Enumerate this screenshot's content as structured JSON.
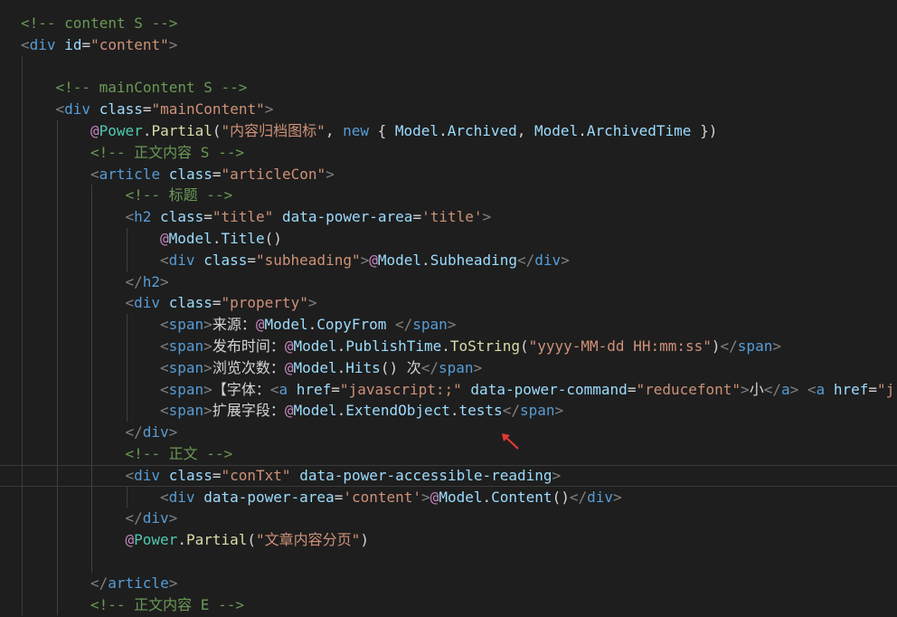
{
  "editor": {
    "lines": [
      {
        "indent": 0,
        "tokens": [
          {
            "t": "<!-- content S -->",
            "c": "cmt"
          }
        ]
      },
      {
        "indent": 0,
        "tokens": [
          {
            "t": "<",
            "c": "brk"
          },
          {
            "t": "div",
            "c": "tag"
          },
          {
            "t": " ",
            "c": "txt"
          },
          {
            "t": "id",
            "c": "attr"
          },
          {
            "t": "=",
            "c": "txt"
          },
          {
            "t": "\"content\"",
            "c": "str"
          },
          {
            "t": ">",
            "c": "brk"
          }
        ]
      },
      {
        "indent": 0,
        "tokens": []
      },
      {
        "indent": 1,
        "tokens": [
          {
            "t": "<!-- mainContent S -->",
            "c": "cmt"
          }
        ]
      },
      {
        "indent": 1,
        "tokens": [
          {
            "t": "<",
            "c": "brk"
          },
          {
            "t": "div",
            "c": "tag"
          },
          {
            "t": " ",
            "c": "txt"
          },
          {
            "t": "class",
            "c": "attr"
          },
          {
            "t": "=",
            "c": "txt"
          },
          {
            "t": "\"mainContent\"",
            "c": "str"
          },
          {
            "t": ">",
            "c": "brk"
          }
        ]
      },
      {
        "indent": 2,
        "tokens": [
          {
            "t": "@",
            "c": "at"
          },
          {
            "t": "Power",
            "c": "cls"
          },
          {
            "t": ".",
            "c": "txt"
          },
          {
            "t": "Partial",
            "c": "fn"
          },
          {
            "t": "(",
            "c": "txt"
          },
          {
            "t": "\"内容归档图标\"",
            "c": "str"
          },
          {
            "t": ", ",
            "c": "txt"
          },
          {
            "t": "new",
            "c": "kw"
          },
          {
            "t": " { ",
            "c": "txt"
          },
          {
            "t": "Model",
            "c": "attr"
          },
          {
            "t": ".",
            "c": "txt"
          },
          {
            "t": "Archived",
            "c": "attr"
          },
          {
            "t": ", ",
            "c": "txt"
          },
          {
            "t": "Model",
            "c": "attr"
          },
          {
            "t": ".",
            "c": "txt"
          },
          {
            "t": "ArchivedTime",
            "c": "attr"
          },
          {
            "t": " })",
            "c": "txt"
          }
        ]
      },
      {
        "indent": 2,
        "tokens": [
          {
            "t": "<!-- 正文内容 S -->",
            "c": "cmt"
          }
        ]
      },
      {
        "indent": 2,
        "tokens": [
          {
            "t": "<",
            "c": "brk"
          },
          {
            "t": "article",
            "c": "tag"
          },
          {
            "t": " ",
            "c": "txt"
          },
          {
            "t": "class",
            "c": "attr"
          },
          {
            "t": "=",
            "c": "txt"
          },
          {
            "t": "\"articleCon\"",
            "c": "str"
          },
          {
            "t": ">",
            "c": "brk"
          }
        ]
      },
      {
        "indent": 3,
        "tokens": [
          {
            "t": "<!-- 标题 -->",
            "c": "cmt"
          }
        ]
      },
      {
        "indent": 3,
        "tokens": [
          {
            "t": "<",
            "c": "brk"
          },
          {
            "t": "h2",
            "c": "tag"
          },
          {
            "t": " ",
            "c": "txt"
          },
          {
            "t": "class",
            "c": "attr"
          },
          {
            "t": "=",
            "c": "txt"
          },
          {
            "t": "\"title\"",
            "c": "str"
          },
          {
            "t": " ",
            "c": "txt"
          },
          {
            "t": "data-power-area",
            "c": "attr"
          },
          {
            "t": "=",
            "c": "txt"
          },
          {
            "t": "'title'",
            "c": "str"
          },
          {
            "t": ">",
            "c": "brk"
          }
        ]
      },
      {
        "indent": 4,
        "tokens": [
          {
            "t": "@",
            "c": "at"
          },
          {
            "t": "Model",
            "c": "attr"
          },
          {
            "t": ".",
            "c": "txt"
          },
          {
            "t": "Title",
            "c": "attr"
          },
          {
            "t": "()",
            "c": "txt"
          }
        ]
      },
      {
        "indent": 4,
        "tokens": [
          {
            "t": "<",
            "c": "brk"
          },
          {
            "t": "div",
            "c": "tag"
          },
          {
            "t": " ",
            "c": "txt"
          },
          {
            "t": "class",
            "c": "attr"
          },
          {
            "t": "=",
            "c": "txt"
          },
          {
            "t": "\"subheading\"",
            "c": "str"
          },
          {
            "t": ">",
            "c": "brk"
          },
          {
            "t": "@",
            "c": "at"
          },
          {
            "t": "Model",
            "c": "attr"
          },
          {
            "t": ".",
            "c": "txt"
          },
          {
            "t": "Subheading",
            "c": "attr"
          },
          {
            "t": "</",
            "c": "brk"
          },
          {
            "t": "div",
            "c": "tag"
          },
          {
            "t": ">",
            "c": "brk"
          }
        ]
      },
      {
        "indent": 3,
        "tokens": [
          {
            "t": "</",
            "c": "brk"
          },
          {
            "t": "h2",
            "c": "tag"
          },
          {
            "t": ">",
            "c": "brk"
          }
        ]
      },
      {
        "indent": 3,
        "tokens": [
          {
            "t": "<",
            "c": "brk"
          },
          {
            "t": "div",
            "c": "tag"
          },
          {
            "t": " ",
            "c": "txt"
          },
          {
            "t": "class",
            "c": "attr"
          },
          {
            "t": "=",
            "c": "txt"
          },
          {
            "t": "\"property\"",
            "c": "str"
          },
          {
            "t": ">",
            "c": "brk"
          }
        ]
      },
      {
        "indent": 4,
        "tokens": [
          {
            "t": "<",
            "c": "brk"
          },
          {
            "t": "span",
            "c": "tag"
          },
          {
            "t": ">",
            "c": "brk"
          },
          {
            "t": "来源：",
            "c": "txt"
          },
          {
            "t": "@",
            "c": "at"
          },
          {
            "t": "Model",
            "c": "attr"
          },
          {
            "t": ".",
            "c": "txt"
          },
          {
            "t": "CopyFrom",
            "c": "attr"
          },
          {
            "t": " ",
            "c": "txt"
          },
          {
            "t": "</",
            "c": "brk"
          },
          {
            "t": "span",
            "c": "tag"
          },
          {
            "t": ">",
            "c": "brk"
          }
        ]
      },
      {
        "indent": 4,
        "tokens": [
          {
            "t": "<",
            "c": "brk"
          },
          {
            "t": "span",
            "c": "tag"
          },
          {
            "t": ">",
            "c": "brk"
          },
          {
            "t": "发布时间：",
            "c": "txt"
          },
          {
            "t": "@",
            "c": "at"
          },
          {
            "t": "Model",
            "c": "attr"
          },
          {
            "t": ".",
            "c": "txt"
          },
          {
            "t": "PublishTime",
            "c": "attr"
          },
          {
            "t": ".",
            "c": "txt"
          },
          {
            "t": "ToString",
            "c": "fn"
          },
          {
            "t": "(",
            "c": "txt"
          },
          {
            "t": "\"yyyy-MM-dd HH:mm:ss\"",
            "c": "str"
          },
          {
            "t": ")",
            "c": "txt"
          },
          {
            "t": "</",
            "c": "brk"
          },
          {
            "t": "span",
            "c": "tag"
          },
          {
            "t": ">",
            "c": "brk"
          }
        ]
      },
      {
        "indent": 4,
        "tokens": [
          {
            "t": "<",
            "c": "brk"
          },
          {
            "t": "span",
            "c": "tag"
          },
          {
            "t": ">",
            "c": "brk"
          },
          {
            "t": "浏览次数：",
            "c": "txt"
          },
          {
            "t": "@",
            "c": "at"
          },
          {
            "t": "Model",
            "c": "attr"
          },
          {
            "t": ".",
            "c": "txt"
          },
          {
            "t": "Hits",
            "c": "attr"
          },
          {
            "t": "() 次",
            "c": "txt"
          },
          {
            "t": "</",
            "c": "brk"
          },
          {
            "t": "span",
            "c": "tag"
          },
          {
            "t": ">",
            "c": "brk"
          }
        ]
      },
      {
        "indent": 4,
        "tokens": [
          {
            "t": "<",
            "c": "brk"
          },
          {
            "t": "span",
            "c": "tag"
          },
          {
            "t": ">",
            "c": "brk"
          },
          {
            "t": "【字体：",
            "c": "txt"
          },
          {
            "t": "<",
            "c": "brk"
          },
          {
            "t": "a",
            "c": "tag"
          },
          {
            "t": " ",
            "c": "txt"
          },
          {
            "t": "href",
            "c": "attr"
          },
          {
            "t": "=",
            "c": "txt"
          },
          {
            "t": "\"javascript:;\"",
            "c": "str"
          },
          {
            "t": " ",
            "c": "txt"
          },
          {
            "t": "data-power-command",
            "c": "attr"
          },
          {
            "t": "=",
            "c": "txt"
          },
          {
            "t": "\"reducefont\"",
            "c": "str"
          },
          {
            "t": ">",
            "c": "brk"
          },
          {
            "t": "小",
            "c": "txt"
          },
          {
            "t": "</",
            "c": "brk"
          },
          {
            "t": "a",
            "c": "tag"
          },
          {
            "t": ">",
            "c": "brk"
          },
          {
            "t": " ",
            "c": "txt"
          },
          {
            "t": "<",
            "c": "brk"
          },
          {
            "t": "a",
            "c": "tag"
          },
          {
            "t": " ",
            "c": "txt"
          },
          {
            "t": "href",
            "c": "attr"
          },
          {
            "t": "=",
            "c": "txt"
          },
          {
            "t": "\"j",
            "c": "str"
          }
        ]
      },
      {
        "indent": 4,
        "tokens": [
          {
            "t": "<",
            "c": "brk"
          },
          {
            "t": "span",
            "c": "tag"
          },
          {
            "t": ">",
            "c": "brk"
          },
          {
            "t": "扩展字段：",
            "c": "txt"
          },
          {
            "t": "@",
            "c": "at"
          },
          {
            "t": "Model",
            "c": "attr"
          },
          {
            "t": ".",
            "c": "txt"
          },
          {
            "t": "ExtendObject",
            "c": "attr"
          },
          {
            "t": ".",
            "c": "txt"
          },
          {
            "t": "tests",
            "c": "attr"
          },
          {
            "t": "</",
            "c": "brk"
          },
          {
            "t": "span",
            "c": "tag"
          },
          {
            "t": ">",
            "c": "brk"
          }
        ]
      },
      {
        "indent": 3,
        "tokens": [
          {
            "t": "</",
            "c": "brk"
          },
          {
            "t": "div",
            "c": "tag"
          },
          {
            "t": ">",
            "c": "brk"
          }
        ]
      },
      {
        "indent": 3,
        "tokens": [
          {
            "t": "<!-- 正文 -->",
            "c": "cmt"
          }
        ]
      },
      {
        "indent": 3,
        "current": true,
        "tokens": [
          {
            "t": "<",
            "c": "brk"
          },
          {
            "t": "div",
            "c": "tag"
          },
          {
            "t": " ",
            "c": "txt"
          },
          {
            "t": "class",
            "c": "attr"
          },
          {
            "t": "=",
            "c": "txt"
          },
          {
            "t": "\"conTxt\"",
            "c": "str"
          },
          {
            "t": " ",
            "c": "txt"
          },
          {
            "t": "data-power-accessible-reading",
            "c": "attr"
          },
          {
            "t": ">",
            "c": "brk"
          }
        ]
      },
      {
        "indent": 4,
        "tokens": [
          {
            "t": "<",
            "c": "brk"
          },
          {
            "t": "div",
            "c": "tag"
          },
          {
            "t": " ",
            "c": "txt"
          },
          {
            "t": "data-power-area",
            "c": "attr"
          },
          {
            "t": "=",
            "c": "txt"
          },
          {
            "t": "'content'",
            "c": "str"
          },
          {
            "t": ">",
            "c": "brk"
          },
          {
            "t": "@",
            "c": "at"
          },
          {
            "t": "Model",
            "c": "attr"
          },
          {
            "t": ".",
            "c": "txt"
          },
          {
            "t": "Content",
            "c": "attr"
          },
          {
            "t": "()",
            "c": "txt"
          },
          {
            "t": "</",
            "c": "brk"
          },
          {
            "t": "div",
            "c": "tag"
          },
          {
            "t": ">",
            "c": "brk"
          }
        ]
      },
      {
        "indent": 3,
        "tokens": [
          {
            "t": "</",
            "c": "brk"
          },
          {
            "t": "div",
            "c": "tag"
          },
          {
            "t": ">",
            "c": "brk"
          }
        ]
      },
      {
        "indent": 3,
        "tokens": [
          {
            "t": "@",
            "c": "at"
          },
          {
            "t": "Power",
            "c": "cls"
          },
          {
            "t": ".",
            "c": "txt"
          },
          {
            "t": "Partial",
            "c": "fn"
          },
          {
            "t": "(",
            "c": "txt"
          },
          {
            "t": "\"文章内容分页\"",
            "c": "str"
          },
          {
            "t": ")",
            "c": "txt"
          }
        ]
      },
      {
        "indent": 0,
        "tokens": []
      },
      {
        "indent": 2,
        "tokens": [
          {
            "t": "</",
            "c": "brk"
          },
          {
            "t": "article",
            "c": "tag"
          },
          {
            "t": ">",
            "c": "brk"
          }
        ]
      },
      {
        "indent": 2,
        "tokens": [
          {
            "t": "<!-- 正文内容 E -->",
            "c": "cmt"
          }
        ]
      }
    ]
  },
  "annotation": {
    "icon": "red-arrow-icon",
    "color": "#e53935"
  }
}
